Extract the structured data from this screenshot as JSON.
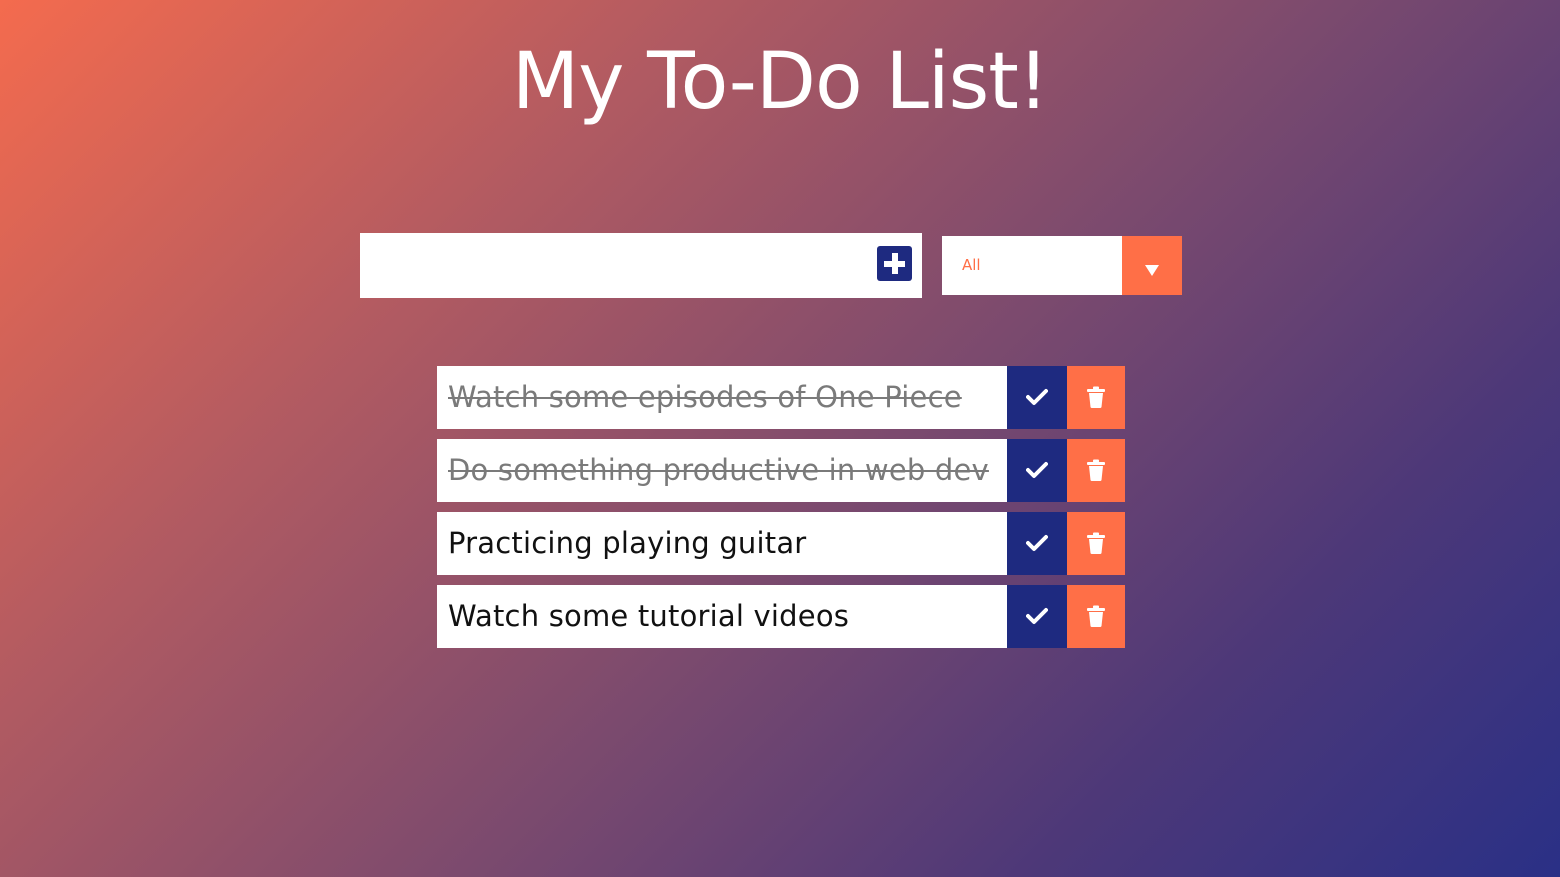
{
  "app": {
    "title": "My To-Do List!"
  },
  "input": {
    "value": "",
    "placeholder": ""
  },
  "add_button": {
    "icon": "plus-square-icon"
  },
  "filter": {
    "selected": "All",
    "icon": "triangle-down-icon"
  },
  "todos": [
    {
      "text": "Watch some episodes of One Piece",
      "completed": true
    },
    {
      "text": "Do something productive in web dev",
      "completed": true
    },
    {
      "text": "Practicing playing guitar",
      "completed": false
    },
    {
      "text": "Watch some tutorial videos",
      "completed": false
    }
  ],
  "icons": {
    "complete": "check-icon",
    "delete": "trash-icon"
  },
  "colors": {
    "accent_blue": "#1e2a80",
    "accent_orange": "#ff6f47",
    "gradient_start": "#f46b4e",
    "gradient_end": "#2a3086"
  }
}
